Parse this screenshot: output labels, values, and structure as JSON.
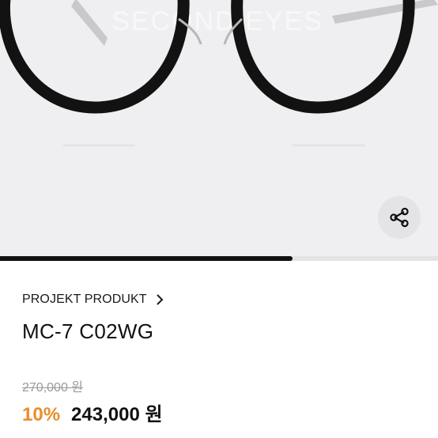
{
  "product": {
    "image_watermark": "SECOND EYES",
    "carousel_progress": 0.667,
    "brand": "PROJEKT PRODUKT",
    "name": "MC-7 C02WG",
    "original_price": "270,000 원",
    "discount_rate": "10%",
    "sale_price": "243,000 원"
  },
  "icons": {
    "share": "share-icon",
    "brand_chevron": "chevron-right-icon"
  },
  "colors": {
    "image_background": "#efeff1",
    "discount": "#e98d2c",
    "progress_fill": "#111111",
    "progress_track": "#e3e3e5",
    "frame": "#121212",
    "temple": "#c9c9cb"
  }
}
